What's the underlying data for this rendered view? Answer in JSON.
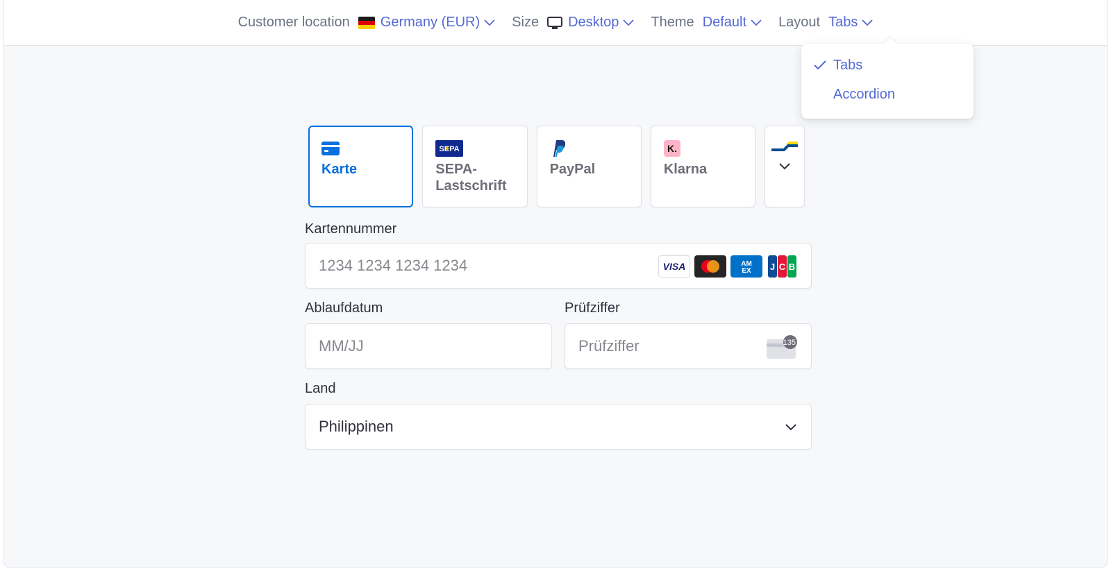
{
  "topbar": {
    "customer_location_label": "Customer location",
    "customer_location_value": "Germany (EUR)",
    "size_label": "Size",
    "size_value": "Desktop",
    "theme_label": "Theme",
    "theme_value": "Default",
    "layout_label": "Layout",
    "layout_value": "Tabs"
  },
  "layout_menu": {
    "options": [
      "Tabs",
      "Accordion"
    ],
    "selected": "Tabs"
  },
  "payment_tabs": [
    {
      "label": "Karte",
      "icon": "credit-card-icon",
      "active": true
    },
    {
      "label": "SEPA-\nLastschrift",
      "icon": "sepa-icon",
      "active": false
    },
    {
      "label": "PayPal",
      "icon": "paypal-icon",
      "active": false
    },
    {
      "label": "Klarna",
      "icon": "klarna-icon",
      "active": false
    }
  ],
  "form": {
    "card_number_label": "Kartennummer",
    "card_number_placeholder": "1234 1234 1234 1234",
    "expiry_label": "Ablaufdatum",
    "expiry_placeholder": "MM/JJ",
    "cvc_label": "Prüfziffer",
    "cvc_placeholder": "Prüfziffer",
    "cvc_icon_text": "135",
    "country_label": "Land",
    "country_value": "Philippinen"
  },
  "card_brands": [
    "VISA",
    "Mastercard",
    "AMEX",
    "JCB"
  ],
  "colors": {
    "accent": "#5469d4",
    "active_tab": "#0570de",
    "background": "#f6f8fa"
  }
}
